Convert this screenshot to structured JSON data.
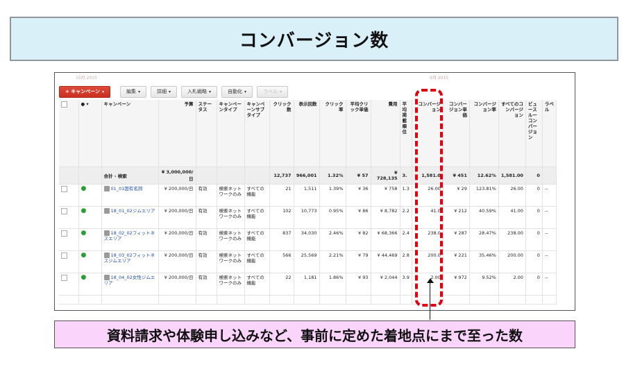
{
  "title": "コンバージョン数",
  "caption": "資料請求や体験申し込みなど、事前に定めた着地点にまで至った数",
  "faint_dates": {
    "left": "10月 2015",
    "right": "9月 2015"
  },
  "toolbar": {
    "campaign": "+ キャンペーン",
    "edit": "編集",
    "detail": "詳細",
    "bid_strategy": "入札戦略",
    "automate": "自動化",
    "label": "ラベル"
  },
  "columns": {
    "campaign": "キャンペーン",
    "budget": "予算",
    "status": "ステータス",
    "campaign_type": "キャンペーンタイプ",
    "campaign_subtype": "キャンペーンサブタイプ",
    "clicks": "クリック数",
    "impressions": "表示回数",
    "ctr": "クリック率",
    "avg_cpc": "平均クリック単価",
    "cost": "費用",
    "avg_pos": "平均掲載順位",
    "conversions": "コンバージョン",
    "cost_per_conv": "コンバージョン単価",
    "conv_rate": "コンバージョン率",
    "all_conv": "すべてのコンバージョン",
    "view_through": "ビュースルーコンバージョン",
    "labels": "ラベル"
  },
  "total": {
    "name": "合計 - 検索",
    "budget": "¥ 3,000,000/日",
    "clicks": "12,737",
    "impressions": "966,001",
    "ctr": "1.32%",
    "avg_cpc": "¥ 57",
    "cost": "¥ 728,135",
    "avg_pos": "3.",
    "conversions": "1,581.0",
    "cost_per_conv": "¥ 451",
    "conv_rate": "12.62%",
    "all_conv": "1,581.00",
    "view_through": "0"
  },
  "rows": [
    {
      "name": "01_01固有名詞",
      "budget": "¥ 200,000/日",
      "status": "有効",
      "type": "検索ネットワークのみ",
      "subtype": "すべての機能",
      "clicks": "21",
      "impressions": "1,511",
      "ctr": "1.39%",
      "avg_cpc": "¥ 36",
      "cost": "¥ 758",
      "avg_pos": "1.3",
      "conversions": "26.00",
      "cost_per_conv": "¥ 29",
      "conv_rate": "123.81%",
      "all_conv": "26.00",
      "view_through": "0",
      "labels": "--"
    },
    {
      "name": "18_01_02ジムエリア",
      "budget": "¥ 200,000/日",
      "status": "有効",
      "type": "検索ネットワークのみ",
      "subtype": "すべての機能",
      "clicks": "102",
      "impressions": "10,773",
      "ctr": "0.95%",
      "avg_cpc": "¥ 86",
      "cost": "¥ 8,782",
      "avg_pos": "2.2",
      "conversions": "41.0",
      "cost_per_conv": "¥ 212",
      "conv_rate": "40.59%",
      "all_conv": "41.00",
      "view_through": "0",
      "labels": "--"
    },
    {
      "name": "18_02_02フィットネスエリア",
      "budget": "¥ 200,000/日",
      "status": "有効",
      "type": "検索ネットワークのみ",
      "subtype": "すべての機能",
      "clicks": "837",
      "impressions": "34,030",
      "ctr": "2.46%",
      "avg_cpc": "¥ 82",
      "cost": "¥ 68,366",
      "avg_pos": "2.4",
      "conversions": "238.0",
      "cost_per_conv": "¥ 287",
      "conv_rate": "28.47%",
      "all_conv": "238.00",
      "view_through": "0",
      "labels": "--"
    },
    {
      "name": "18_03_02フィットネスジムエリア",
      "budget": "¥ 200,000/日",
      "status": "有効",
      "type": "検索ネットワークのみ",
      "subtype": "すべての機能",
      "clicks": "566",
      "impressions": "25,569",
      "ctr": "2.21%",
      "avg_cpc": "¥ 79",
      "cost": "¥ 44,469",
      "avg_pos": "2.8",
      "conversions": "200.0",
      "cost_per_conv": "¥ 221",
      "conv_rate": "35.46%",
      "all_conv": "200.00",
      "view_through": "0",
      "labels": "--"
    },
    {
      "name": "18_04_02女性ジムエリア",
      "budget": "¥ 200,000/日",
      "status": "有効",
      "type": "検索ネットワークのみ",
      "subtype": "すべての機能",
      "clicks": "22",
      "impressions": "1,181",
      "ctr": "1.86%",
      "avg_cpc": "¥ 93",
      "cost": "¥ 2,044",
      "avg_pos": "3.9",
      "conversions": "2.00",
      "cost_per_conv": "¥ 972",
      "conv_rate": "9.52%",
      "all_conv": "2.00",
      "view_through": "0",
      "labels": "--"
    }
  ],
  "colors": {
    "highlight": "#e0000f",
    "title_bg": "#d9f0f8",
    "caption_bg": "#fbd4fb",
    "primary_button": "#d23a2a"
  }
}
